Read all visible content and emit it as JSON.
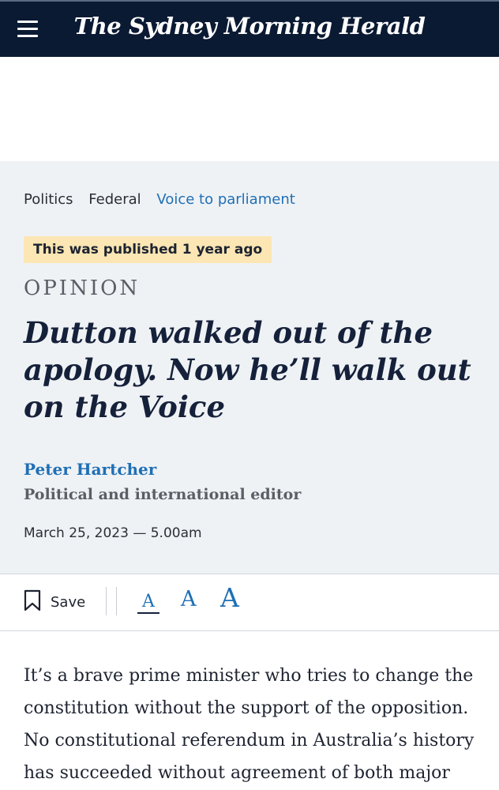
{
  "header": {
    "menu_icon": "hamburger-menu-icon",
    "masthead": "The Sydney Morning Herald"
  },
  "breadcrumbs": [
    {
      "label": "Politics",
      "style": "plain"
    },
    {
      "label": "Federal",
      "style": "plain"
    },
    {
      "label": "Voice to parliament",
      "style": "link"
    }
  ],
  "article": {
    "published_badge": "This was published 1 year ago",
    "kicker": "OPINION",
    "headline": "Dutton walked out of the apology. Now he’ll walk out on the Voice",
    "author_name": "Peter Hartcher",
    "author_role": "Political and international editor",
    "dateline": "March 25, 2023 — 5.00am",
    "body": "It’s a brave prime minister who tries to change the constitution without the support of the opposition. No constitutional referendum in Australia’s history has succeeded without agreement of both major"
  },
  "toolbar": {
    "save_label": "Save",
    "save_icon": "bookmark-icon",
    "font_small": "A",
    "font_medium": "A",
    "font_large": "A"
  },
  "colors": {
    "brand_navy": "#0b1a33",
    "link_blue": "#1f6fb5",
    "badge_yellow": "#fbe6b4",
    "hero_bg": "#eff2f5"
  }
}
